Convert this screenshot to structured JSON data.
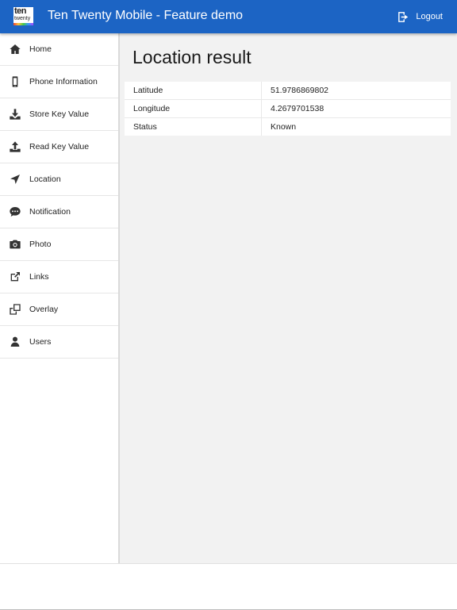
{
  "header": {
    "title": "Ten Twenty Mobile - Feature demo",
    "logo_line1": "ten",
    "logo_line2": "twenty",
    "logout_label": "Logout",
    "background_color": "#1c64c4"
  },
  "sidebar": {
    "items": [
      {
        "label": "Home",
        "icon": "home-icon"
      },
      {
        "label": "Phone Information",
        "icon": "phone-icon"
      },
      {
        "label": "Store Key Value",
        "icon": "download-icon"
      },
      {
        "label": "Read Key Value",
        "icon": "upload-icon"
      },
      {
        "label": "Location",
        "icon": "location-arrow-icon"
      },
      {
        "label": "Notification",
        "icon": "chat-bubble-icon"
      },
      {
        "label": "Photo",
        "icon": "camera-icon"
      },
      {
        "label": "Links",
        "icon": "external-link-icon"
      },
      {
        "label": "Overlay",
        "icon": "overlay-icon"
      },
      {
        "label": "Users",
        "icon": "user-icon"
      }
    ]
  },
  "main": {
    "title": "Location result",
    "rows": [
      {
        "key": "Latitude",
        "value": "51.9786869802"
      },
      {
        "key": "Longitude",
        "value": "4.2679701538"
      },
      {
        "key": "Status",
        "value": "Known"
      }
    ]
  }
}
